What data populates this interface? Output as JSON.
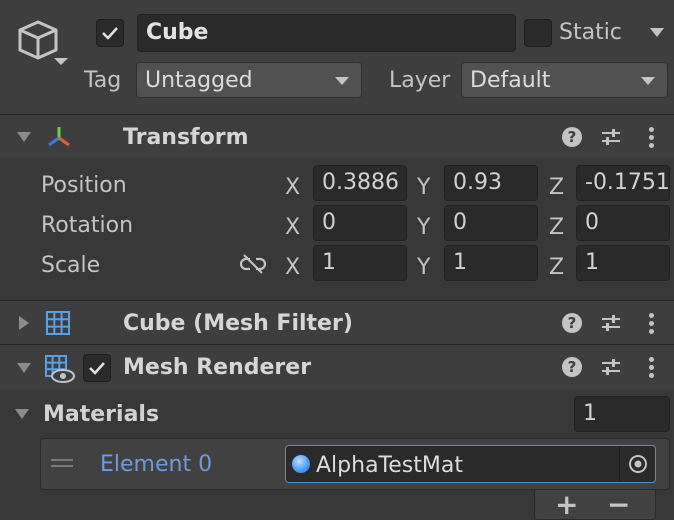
{
  "object": {
    "name": "Cube",
    "active": true,
    "static_label": "Static",
    "static_checked": false,
    "tag_label": "Tag",
    "tag_value": "Untagged",
    "layer_label": "Layer",
    "layer_value": "Default"
  },
  "transform": {
    "title": "Transform",
    "rows": [
      {
        "label": "Position",
        "x": "0.3886",
        "y": "0.93",
        "z": "-0.1751"
      },
      {
        "label": "Rotation",
        "x": "0",
        "y": "0",
        "z": "0"
      },
      {
        "label": "Scale",
        "x": "1",
        "y": "1",
        "z": "1"
      }
    ],
    "axis": {
      "x": "X",
      "y": "Y",
      "z": "Z"
    }
  },
  "mesh_filter": {
    "title": "Cube (Mesh Filter)"
  },
  "mesh_renderer": {
    "title": "Mesh Renderer",
    "enabled": true
  },
  "materials": {
    "label": "Materials",
    "count": "1",
    "element_label": "Element 0",
    "element_value": "AlphaTestMat",
    "add": "+",
    "remove": "−"
  },
  "icons": {
    "help": "?",
    "colors": {
      "bg": "#383838",
      "header": "#3e3e3e",
      "field": "#2a2a2a",
      "accent": "#4d90d8",
      "link": "#6f9ae0"
    }
  }
}
